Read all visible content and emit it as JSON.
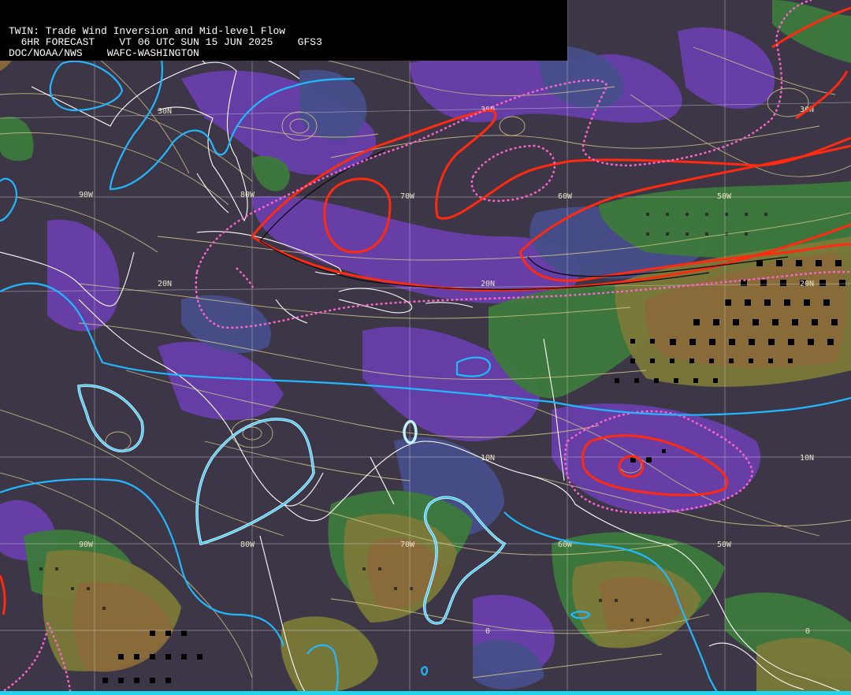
{
  "header": {
    "title": "TWIN: Trade Wind Inversion and Mid-level Flow",
    "forecast_line": "  6HR FORECAST    VT 06 UTC SUN 15 JUN 2025    GFS3",
    "agency_line": "DOC/NOAA/NWS    WAFC-WASHINGTON"
  },
  "grid_labels": {
    "lat": [
      "30N",
      "30N",
      "30N",
      "20N",
      "20N",
      "20N",
      "10N",
      "10N",
      "0",
      "0"
    ],
    "lon": [
      "90W",
      "80W",
      "70W",
      "60W",
      "50W",
      "90W",
      "80W",
      "70W",
      "60W",
      "50W"
    ]
  },
  "colors": {
    "background": "#3c3646",
    "purple_band": "#6a3fb0",
    "blue_band": "#474f8a",
    "green_band": "#3d7a3c",
    "olive_band": "#7a7a38",
    "brown_band": "#8a6a3a",
    "streamline": "#d8c98a",
    "coastline": "#ffffff",
    "grid": "#cfcfcf",
    "red_contour": "#ff2a10",
    "pink_dashed": "#ff66cc",
    "cyan_contour": "#22b8ff",
    "header_bg": "#000000",
    "header_text": "#ffffff"
  }
}
